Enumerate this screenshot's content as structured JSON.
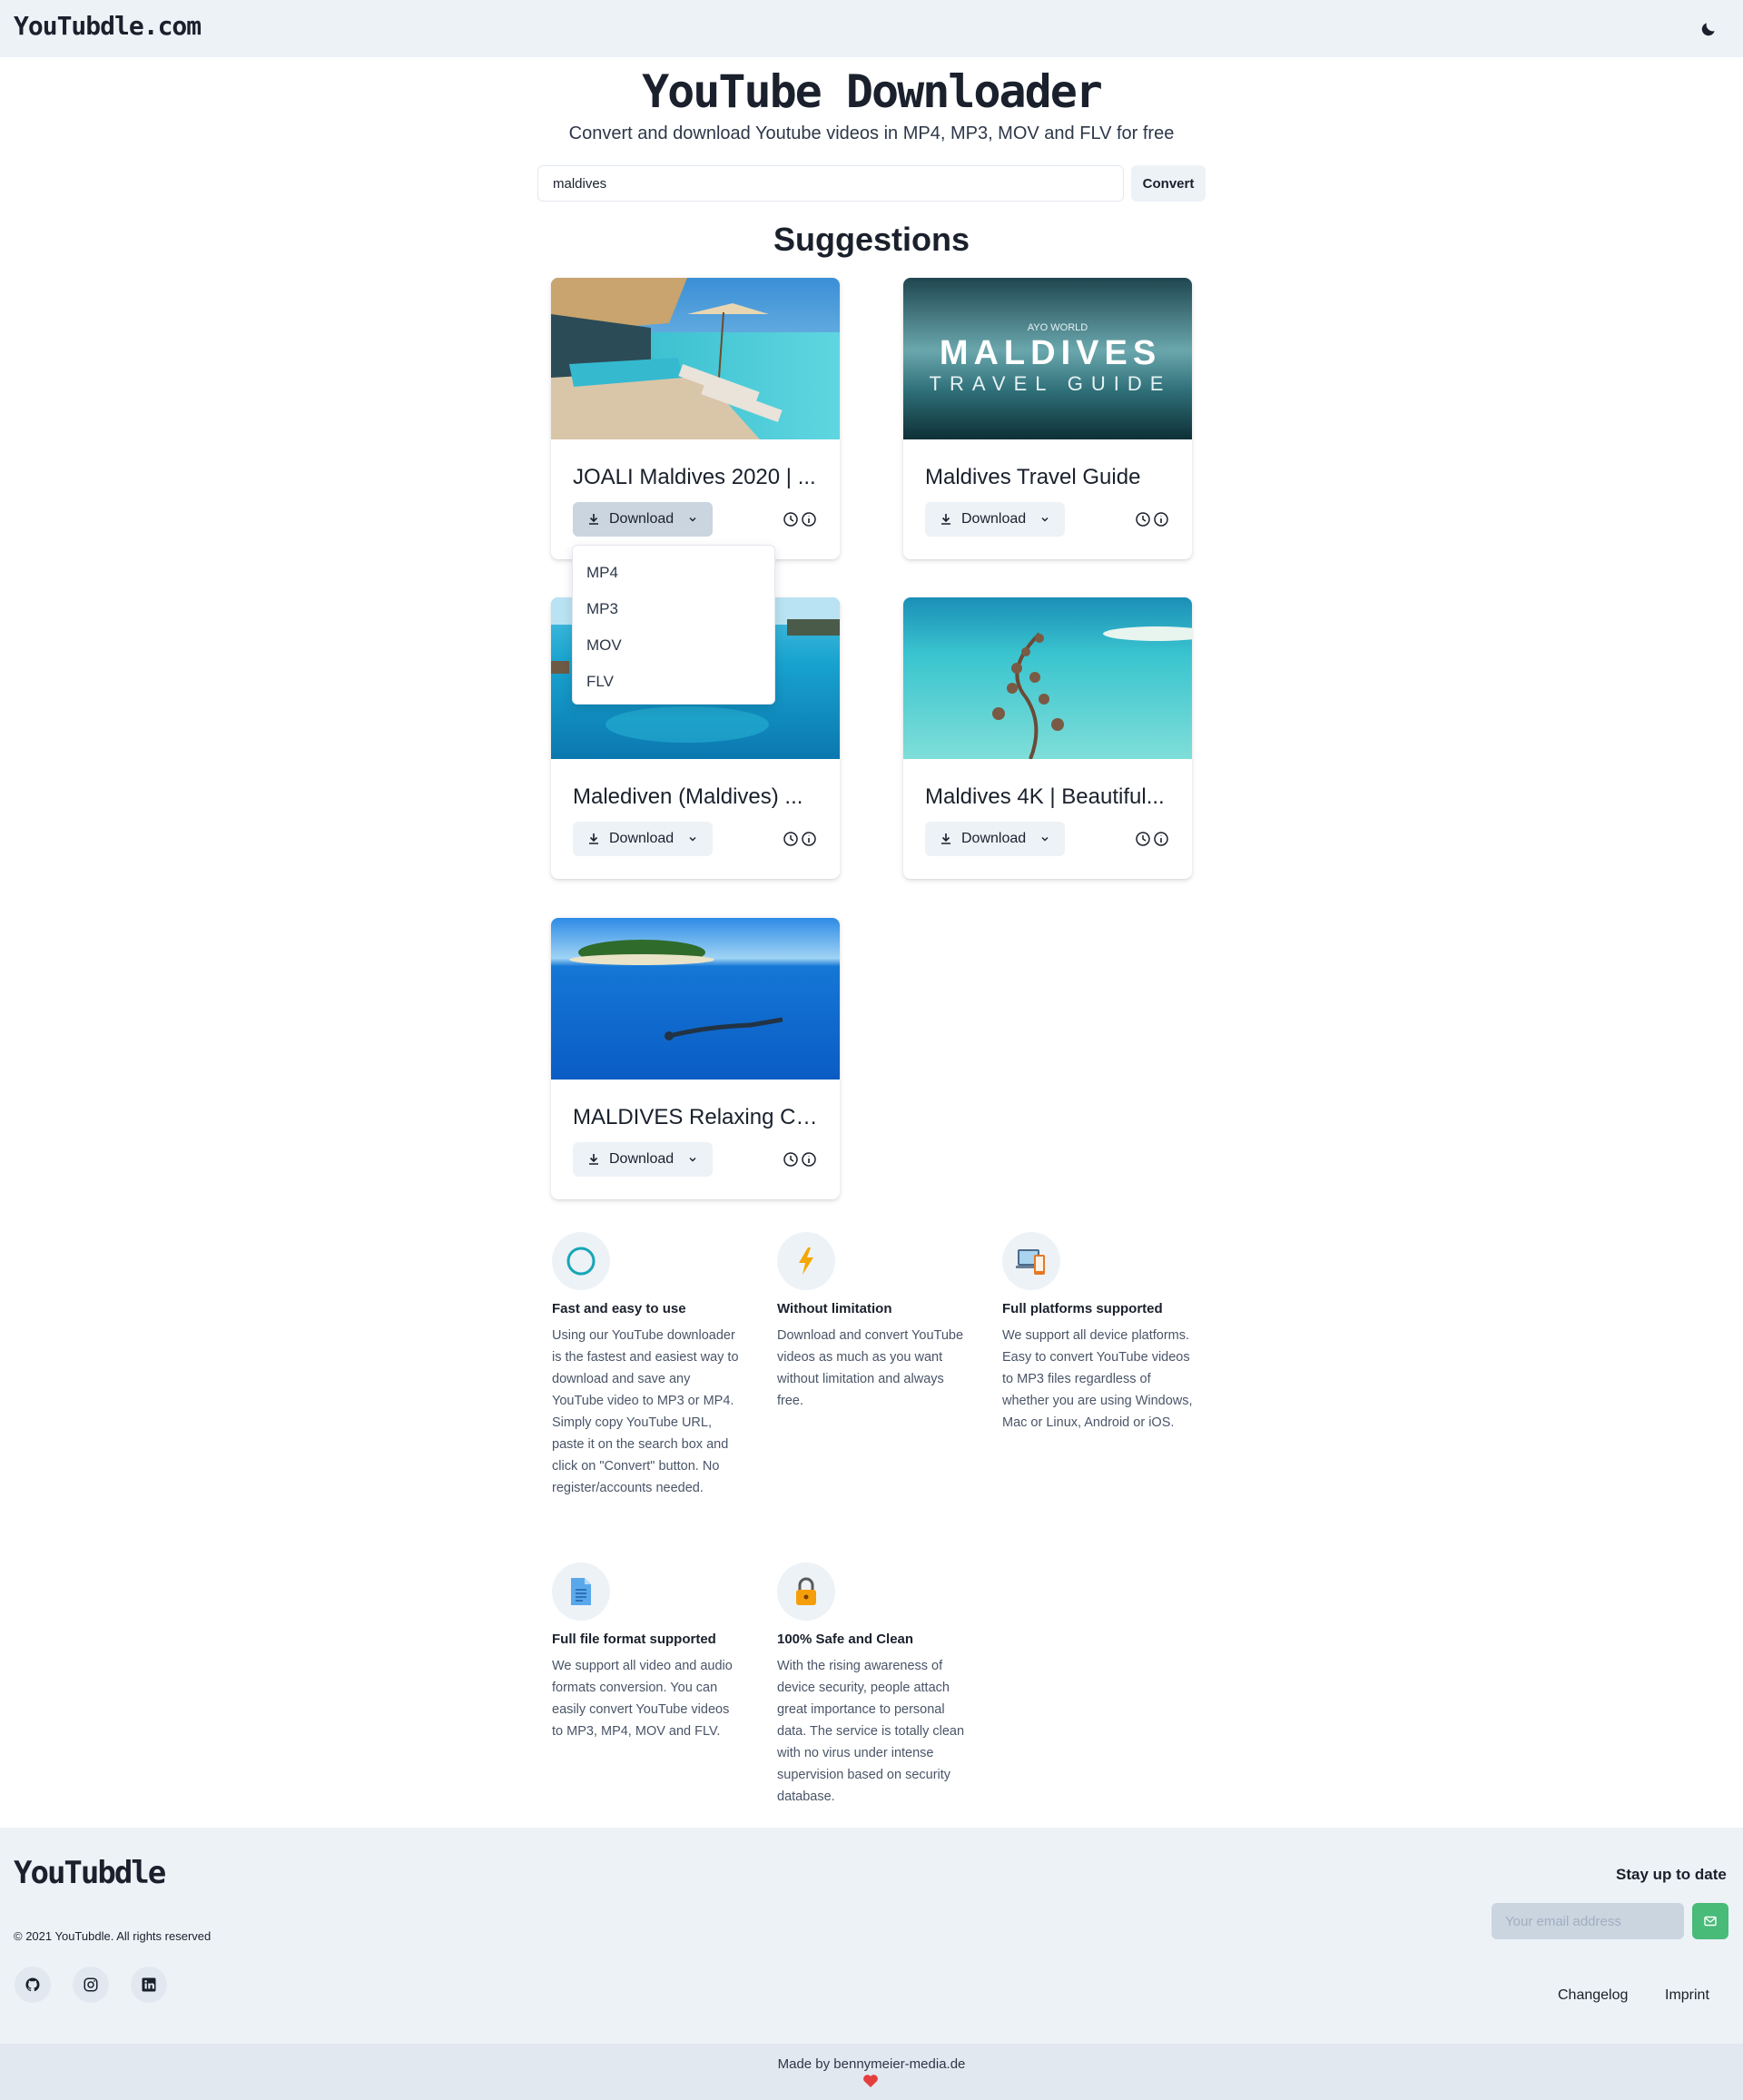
{
  "header": {
    "brand": "YouTubdle.com",
    "theme_icon": "moon-icon"
  },
  "hero": {
    "title": "YouTube Downloader",
    "subtitle": "Convert and download Youtube videos in MP4, MP3, MOV and FLV for free"
  },
  "search": {
    "value": "maldives",
    "convert_label": "Convert"
  },
  "suggestions": {
    "title": "Suggestions",
    "download_label": "Download",
    "videos": [
      {
        "title": "JOALI Maldives 2020 | ...",
        "thumb": "resort-pool-icon"
      },
      {
        "title": "Maldives Travel Guide",
        "thumb": "travel-guide-icon"
      },
      {
        "title": "Malediven (Maldives) ...",
        "thumb": "water-villas-icon"
      },
      {
        "title": "Maldives 4K | Beautiful...",
        "thumb": "island-aerial-icon"
      },
      {
        "title": "MALDIVES Relaxing Ch...",
        "thumb": "underwater-icon"
      }
    ],
    "thumb_overlay": {
      "brand": "AYO WORLD",
      "line1": "MALDIVES",
      "line2": "TRAVEL GUIDE"
    },
    "format_menu": [
      "MP4",
      "MP3",
      "MOV",
      "FLV"
    ]
  },
  "features": [
    {
      "title": "Fast and easy to use",
      "text": "Using our YouTube downloader is the fastest and easiest way to download and save any YouTube video to MP3 or MP4. Simply copy YouTube URL, paste it on the search box and click on \"Convert\" button. No register/accounts needed.",
      "icon": "circle-icon"
    },
    {
      "title": "Without limitation",
      "text": "Download and convert YouTube videos as much as you want without limitation and always free.",
      "icon": "lightning-icon"
    },
    {
      "title": "Full platforms supported",
      "text": "We support all device platforms. Easy to convert YouTube videos to MP3 files regardless of whether you are using Windows, Mac or Linux, Android or iOS.",
      "icon": "devices-icon"
    },
    {
      "title": "Full file format supported",
      "text": "We support all video and audio formats conversion. You can easily convert YouTube videos to MP3, MP4, MOV and FLV.",
      "icon": "document-icon"
    },
    {
      "title": "100% Safe and Clean",
      "text": "With the rising awareness of device security, people attach great importance to personal data. The service is totally clean with no virus under intense supervision based on security database.",
      "icon": "lock-icon"
    }
  ],
  "footer": {
    "brand": "YouTubdle",
    "copyright": "© 2021 YouTubdle. All rights reserved",
    "socials": [
      "github-icon",
      "instagram-icon",
      "linkedin-icon"
    ],
    "newsletter_title": "Stay up to date",
    "email_placeholder": "Your email address",
    "links": [
      "Changelog",
      "Imprint"
    ],
    "made_by": "Made by bennymeier-media.de"
  },
  "colors": {
    "topbar": "#edf2f7",
    "accent_green": "#48bb78",
    "text": "#1a202c"
  }
}
